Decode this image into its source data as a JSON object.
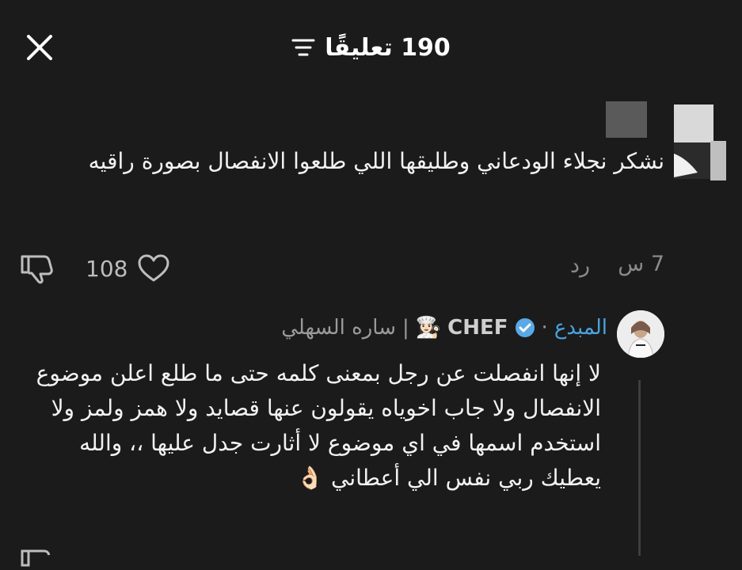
{
  "header": {
    "title": "190 تعليقًا",
    "close_icon": "close-icon",
    "sort_icon": "sort-filter-icon"
  },
  "comment1": {
    "text": "نشكر نجلاء الودعاني وطليقها اللي طلعوا الانفصال بصورة راقيه",
    "time": "7 س",
    "reply_label": "رد",
    "like_count": "108"
  },
  "comment2": {
    "author": "ساره السهلي",
    "separator": "|",
    "badge_text": "CHEF",
    "chef_emoji": "👩🏻‍🍳",
    "dot": "·",
    "role": "المبدع",
    "text": "لا إنها انفصلت عن رجل بمعنى كلمه حتى ما طلع اعلن موضوع الانفصال ولا جاب اخوياه يقولون عنها قصايد ولا همز ولمز ولا استخدم اسمها في اي موضوع لا أثارت جدل عليها ،، والله يعطيك ربي نفس الي أعطاني 👌🏻"
  },
  "colors": {
    "background": "#1b1b1b",
    "text": "#ffffff",
    "muted": "#8a8a8a",
    "role": "#4aa3df",
    "verified": "#5aa9e6"
  }
}
